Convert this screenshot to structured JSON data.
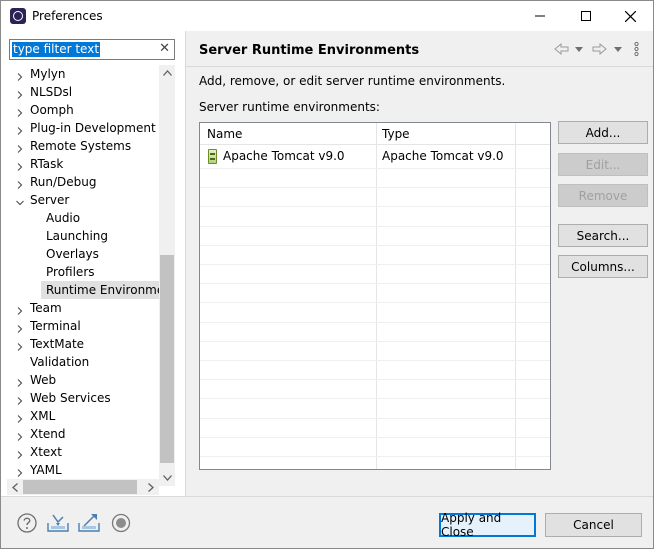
{
  "window": {
    "title": "Preferences"
  },
  "filter": {
    "placeholder": "type filter text"
  },
  "tree": [
    {
      "label": "Mylyn",
      "twisty": "right"
    },
    {
      "label": "NLSDsl",
      "twisty": "right"
    },
    {
      "label": "Oomph",
      "twisty": "right"
    },
    {
      "label": "Plug-in Development",
      "twisty": "right"
    },
    {
      "label": "Remote Systems",
      "twisty": "right"
    },
    {
      "label": "RTask",
      "twisty": "right"
    },
    {
      "label": "Run/Debug",
      "twisty": "right"
    },
    {
      "label": "Server",
      "twisty": "down"
    },
    {
      "label": "Audio",
      "child": true
    },
    {
      "label": "Launching",
      "child": true
    },
    {
      "label": "Overlays",
      "child": true
    },
    {
      "label": "Profilers",
      "child": true
    },
    {
      "label": "Runtime Environmen",
      "child": true,
      "selected": true
    },
    {
      "label": "Team",
      "twisty": "right"
    },
    {
      "label": "Terminal",
      "twisty": "right"
    },
    {
      "label": "TextMate",
      "twisty": "right"
    },
    {
      "label": "Validation"
    },
    {
      "label": "Web",
      "twisty": "right"
    },
    {
      "label": "Web Services",
      "twisty": "right"
    },
    {
      "label": "XML",
      "twisty": "right"
    },
    {
      "label": "Xtend",
      "twisty": "right"
    },
    {
      "label": "Xtext",
      "twisty": "right"
    },
    {
      "label": "YAML",
      "twisty": "right"
    }
  ],
  "page": {
    "title": "Server Runtime Environments",
    "description": "Add, remove, or edit server runtime environments.",
    "table_label": "Server runtime environments:",
    "columns": [
      "Name",
      "Type"
    ],
    "rows": [
      {
        "name": "Apache Tomcat v9.0",
        "type": "Apache Tomcat v9.0"
      }
    ]
  },
  "buttons": {
    "add": "Add...",
    "edit": "Edit...",
    "remove": "Remove",
    "search": "Search...",
    "columns": "Columns...",
    "apply_close": "Apply and Close",
    "cancel": "Cancel"
  },
  "colors": {
    "accent": "#0078d7",
    "selection": "#e0e0e0",
    "panel": "#f0f0f0"
  }
}
